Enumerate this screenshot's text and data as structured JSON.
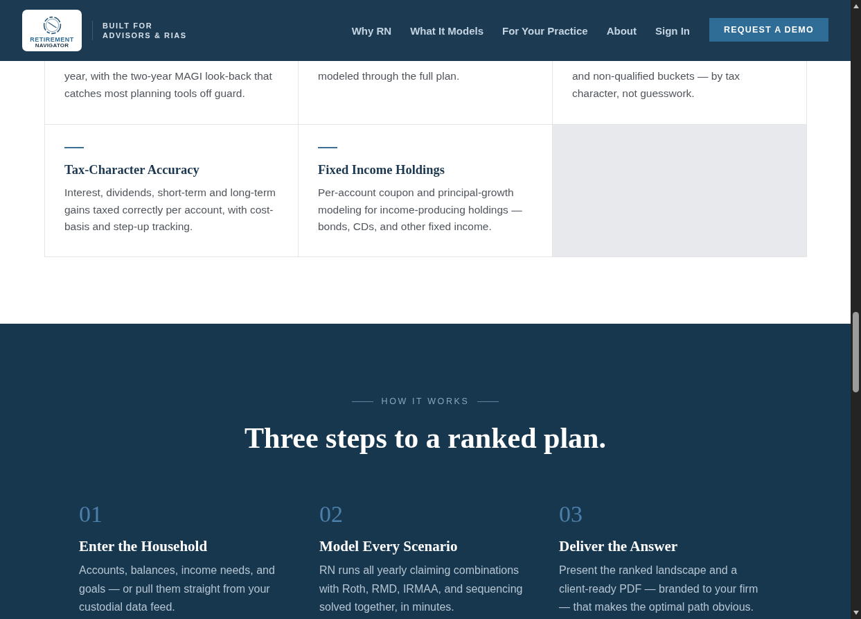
{
  "header": {
    "logo": {
      "lines": [
        "RETIREMENT",
        "NAVIGATOR"
      ]
    },
    "tagline": [
      "BUILT FOR",
      "ADVISORS & RIAS"
    ],
    "nav": [
      {
        "label": "Why RN"
      },
      {
        "label": "What It Models"
      },
      {
        "label": "For Your Practice"
      },
      {
        "label": "About"
      },
      {
        "label": "Sign In"
      }
    ],
    "cta": "REQUEST A DEMO"
  },
  "features": {
    "rows": [
      [
        {
          "kind": "feature",
          "description": "year, with the two-year MAGI look-back that catches most planning tools off guard."
        },
        {
          "kind": "feature",
          "description": "modeled through the full plan."
        },
        {
          "kind": "feature",
          "description": "and non-qualified buckets — by tax character, not guesswork."
        }
      ],
      [
        {
          "kind": "feature",
          "title": "Tax-Character Accuracy",
          "description": "Interest, dividends, short-term and long-term gains taxed correctly per account, with cost-basis and step-up tracking."
        },
        {
          "kind": "feature",
          "title": "Fixed Income Holdings",
          "description": "Per-account coupon and principal-growth modeling for income-producing holdings — bonds, CDs, and other fixed income."
        },
        {
          "kind": "blank"
        }
      ]
    ]
  },
  "how_it_works": {
    "eyebrow": "HOW IT WORKS",
    "heading": "Three steps to a ranked plan.",
    "steps": [
      {
        "number": "01",
        "title": "Enter the Household",
        "description": "Accounts, balances, income needs, and goals — or pull them straight from your custodial data feed."
      },
      {
        "number": "02",
        "title": "Model Every Scenario",
        "description": "RN runs all yearly claiming combinations with Roth, RMD, IRMAA, and sequencing solved together, in minutes."
      },
      {
        "number": "03",
        "title": "Deliver the Answer",
        "description": "Present the ranked landscape and a client-ready PDF — branded to your firm — that makes the optimal path obvious."
      }
    ]
  }
}
